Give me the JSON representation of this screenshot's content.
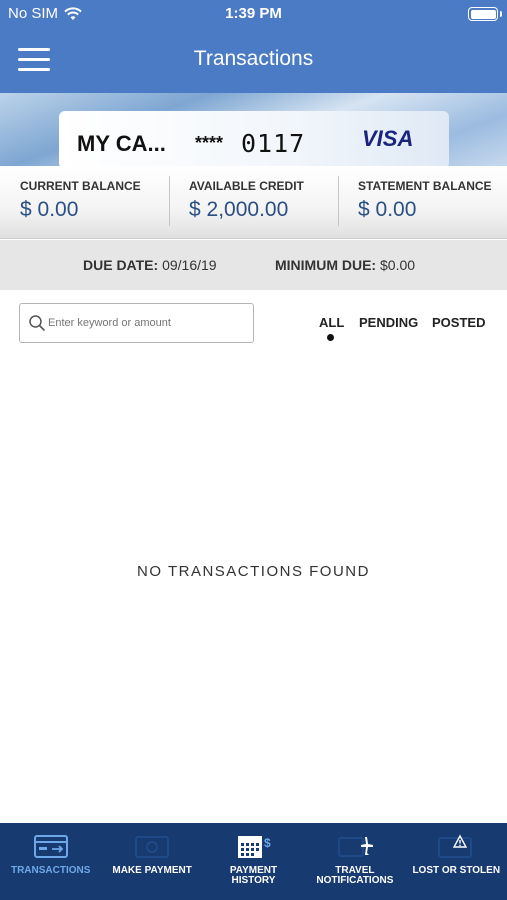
{
  "status_bar": {
    "carrier": "No SIM",
    "time": "1:39 PM",
    "battery_level": 1.0
  },
  "header": {
    "title": "Transactions",
    "menu_icon": "hamburger-menu-icon"
  },
  "card": {
    "name": "MY CA...",
    "masked": "****",
    "last4": "0117",
    "brand": "VISA"
  },
  "balances": [
    {
      "label": "CURRENT BALANCE",
      "value": "$ 0.00"
    },
    {
      "label": "AVAILABLE CREDIT",
      "value": "$ 2,000.00"
    },
    {
      "label": "STATEMENT BALANCE",
      "value": "$ 0.00"
    }
  ],
  "due": {
    "date_label": "DUE DATE:",
    "date_value": "09/16/19",
    "min_label": "MINIMUM DUE:",
    "min_value": "$0.00"
  },
  "search": {
    "placeholder": "Enter keyword or amount",
    "value": ""
  },
  "filters": {
    "selected": "ALL",
    "items": [
      "ALL",
      "PENDING",
      "POSTED"
    ]
  },
  "empty_message": "NO TRANSACTIONS FOUND",
  "tabs": [
    {
      "label": "TRANSACTIONS",
      "icon": "transactions-card-icon",
      "active": true
    },
    {
      "label": "MAKE PAYMENT",
      "icon": "make-payment-icon",
      "active": false
    },
    {
      "label": "PAYMENT HISTORY",
      "icon": "payment-history-calendar-icon",
      "active": false
    },
    {
      "label": "TRAVEL NOTIFICATIONS",
      "icon": "travel-airplane-icon",
      "active": false
    },
    {
      "label": "LOST OR STOLEN",
      "icon": "lost-stolen-warning-icon",
      "active": false
    }
  ],
  "colors": {
    "header": "#4b7bc4",
    "tabbar": "#173a71",
    "active_tab": "#6fa8e8",
    "balance_value": "#2b4f85"
  }
}
